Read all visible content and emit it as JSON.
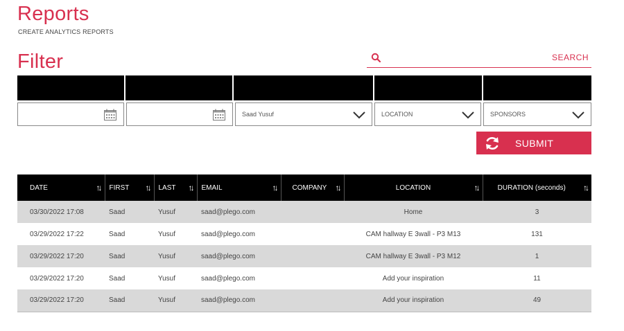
{
  "header": {
    "title": "Reports",
    "subtitle": "CREATE ANALYTICS REPORTS"
  },
  "filter": {
    "title": "Filter",
    "search_placeholder": "",
    "search_label": "SEARCH",
    "date_from": "",
    "date_to": "",
    "user_select": "Saad Yusuf",
    "location_select": "LOCATION",
    "sponsors_select": "SPONSORS",
    "submit_label": "SUBMIT"
  },
  "table": {
    "columns": [
      "DATE",
      "FIRST",
      "LAST",
      "EMAIL",
      "COMPANY",
      "LOCATION",
      "DURATION (seconds)"
    ],
    "rows": [
      [
        "03/30/2022 17:08",
        "Saad",
        "Yusuf",
        "saad@plego.com",
        "",
        "Home",
        "3"
      ],
      [
        "03/29/2022 17:22",
        "Saad",
        "Yusuf",
        "saad@plego.com",
        "",
        "CAM hallway E 3wall - P3 M13",
        "131"
      ],
      [
        "03/29/2022 17:20",
        "Saad",
        "Yusuf",
        "saad@plego.com",
        "",
        "CAM hallway E 3wall - P3 M12",
        "1"
      ],
      [
        "03/29/2022 17:20",
        "Saad",
        "Yusuf",
        "saad@plego.com",
        "",
        "Add your inspiration",
        "11"
      ],
      [
        "03/29/2022 17:20",
        "Saad",
        "Yusuf",
        "saad@plego.com",
        "",
        "Add your inspiration",
        "49"
      ]
    ]
  },
  "colors": {
    "accent": "#d8304f",
    "header_bg": "#000000",
    "row_alt": "#d9d9d9"
  },
  "icons": {
    "search": "search-icon",
    "calendar": "calendar-icon",
    "dropdown": "chevron-down-icon",
    "submit": "refresh-icon",
    "sort": "sort-icon"
  }
}
